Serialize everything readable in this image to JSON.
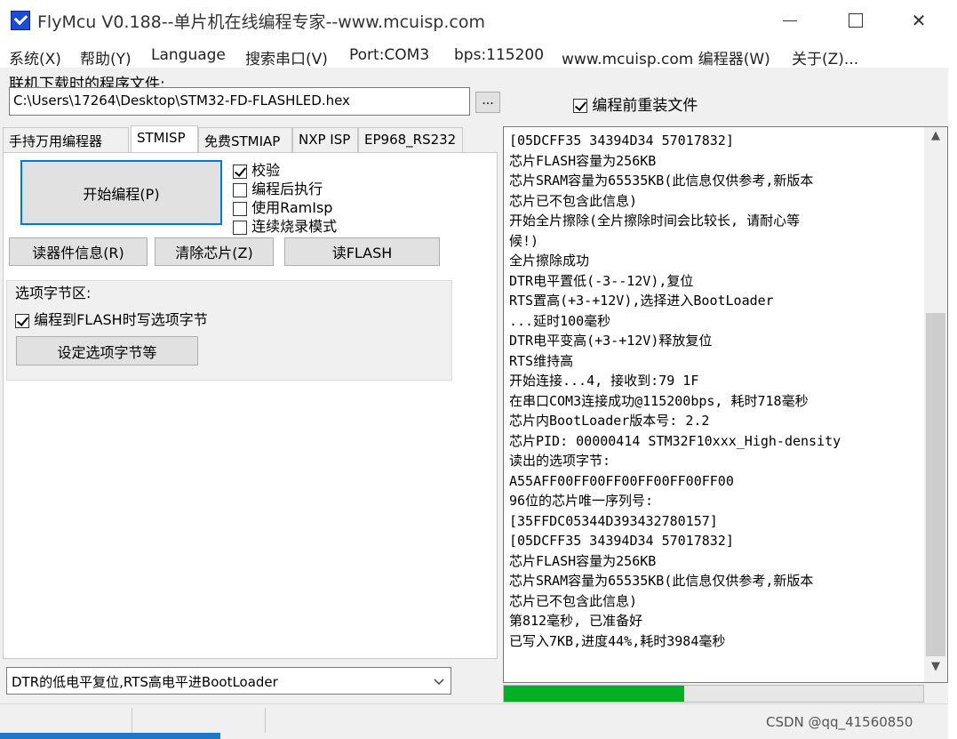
{
  "window": {
    "title": "FlyMcu V0.188--单片机在线编程专家--www.mcuisp.com"
  },
  "menu": [
    "系统(X)",
    "帮助(Y)",
    "Language",
    "搜索串口(V)",
    "Port:COM3",
    "bps:115200",
    "www.mcuisp.com 编程器(W)",
    "关于(Z)..."
  ],
  "file": {
    "label": "联机下载时的程序文件:",
    "path": "C:\\Users\\17264\\Desktop\\STM32-FD-FLASHLED.hex",
    "browse_label": "...",
    "reload_label": "编程前重装文件",
    "reload_checked": true
  },
  "tabs": [
    "手持万用编程器",
    "STMISP",
    "免费STMIAP",
    "NXP ISP",
    "EP968_RS232"
  ],
  "active_tab": "STMISP",
  "stmisp": {
    "start_button": "开始编程(P)",
    "options": [
      {
        "label": "校验",
        "checked": true
      },
      {
        "label": "编程后执行",
        "checked": false
      },
      {
        "label": "使用RamIsp",
        "checked": false
      },
      {
        "label": "连续烧录模式",
        "checked": false
      }
    ],
    "read_info_button": "读器件信息(R)",
    "erase_button": "清除芯片(Z)",
    "read_flash_button": "读FLASH",
    "option_group_title": "选项字节区:",
    "write_option_label": "编程到FLASH时写选项字节",
    "write_option_checked": true,
    "set_option_button": "设定选项字节等",
    "mode_select": "DTR的低电平复位,RTS高电平进BootLoader"
  },
  "log": [
    "[05DCFF35 34394D34 57017832]",
    "芯片FLASH容量为256KB",
    "芯片SRAM容量为65535KB(此信息仅供参考,新版本",
    "芯片已不包含此信息)",
    "开始全片擦除(全片擦除时间会比较长, 请耐心等",
    "候!)",
    "全片擦除成功",
    "DTR电平置低(-3--12V),复位",
    "RTS置高(+3-+12V),选择进入BootLoader",
    "...延时100毫秒",
    "DTR电平变高(+3-+12V)释放复位",
    "RTS维持高",
    "开始连接...4, 接收到:79 1F",
    "在串口COM3连接成功@115200bps, 耗时718毫秒",
    "芯片内BootLoader版本号: 2.2",
    "芯片PID: 00000414  STM32F10xxx_High-density",
    "读出的选项字节:",
    "A55AFF00FF00FF00FF00FF00FF00",
    "96位的芯片唯一序列号:",
    "[35FFDC05344D393432780157]",
    "[05DCFF35 34394D34 57017832]",
    "芯片FLASH容量为256KB",
    "芯片SRAM容量为65535KB(此信息仅供参考,新版本",
    "芯片已不包含此信息)",
    "第812毫秒, 已准备好",
    "已写入7KB,进度44%,耗时3984毫秒"
  ],
  "progress": {
    "fraction": 0.43
  },
  "status": {
    "watermark": "CSDN @qq_41560850"
  },
  "colors": {
    "accent": "#0078d7",
    "progress": "#06b025"
  }
}
